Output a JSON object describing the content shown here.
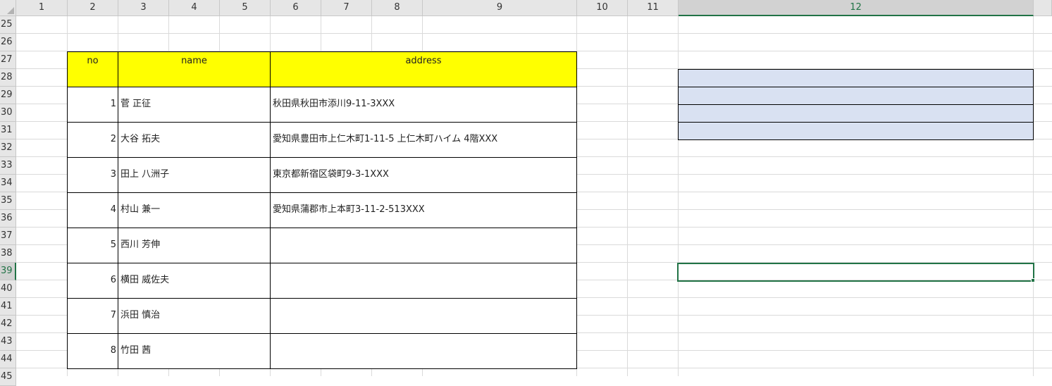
{
  "sheet": {
    "columns": [
      "1",
      "2",
      "3",
      "4",
      "5",
      "6",
      "7",
      "8",
      "9",
      "10",
      "11",
      "12"
    ],
    "rows": [
      "25",
      "26",
      "27",
      "28",
      "29",
      "30",
      "31",
      "32",
      "33",
      "34",
      "35",
      "36",
      "37",
      "38",
      "39",
      "40",
      "41",
      "42",
      "43",
      "44",
      "45"
    ],
    "selected_column": "12",
    "selected_row": "39",
    "colors": {
      "header_fill": "#ffff00",
      "blue_fill": "#d9e1f2",
      "selection": "#217346"
    }
  },
  "table": {
    "headers": {
      "no": "no",
      "name": "name",
      "address": "address"
    },
    "rows": [
      {
        "no": "1",
        "name": "菅 正征",
        "address": "秋田県秋田市添川9-11-3XXX"
      },
      {
        "no": "2",
        "name": "大谷 拓夫",
        "address": "愛知県豊田市上仁木町1-11-5 上仁木町ハイム 4階XXX"
      },
      {
        "no": "3",
        "name": "田上 八洲子",
        "address": "東京都新宿区袋町9-3-1XXX"
      },
      {
        "no": "4",
        "name": "村山 兼一",
        "address": "愛知県蒲郡市上本町3-11-2-513XXX"
      },
      {
        "no": "5",
        "name": "西川 芳伸",
        "address": ""
      },
      {
        "no": "6",
        "name": "横田 威佐夫",
        "address": ""
      },
      {
        "no": "7",
        "name": "浜田 慎治",
        "address": ""
      },
      {
        "no": "8",
        "name": "竹田 茜",
        "address": ""
      }
    ]
  }
}
